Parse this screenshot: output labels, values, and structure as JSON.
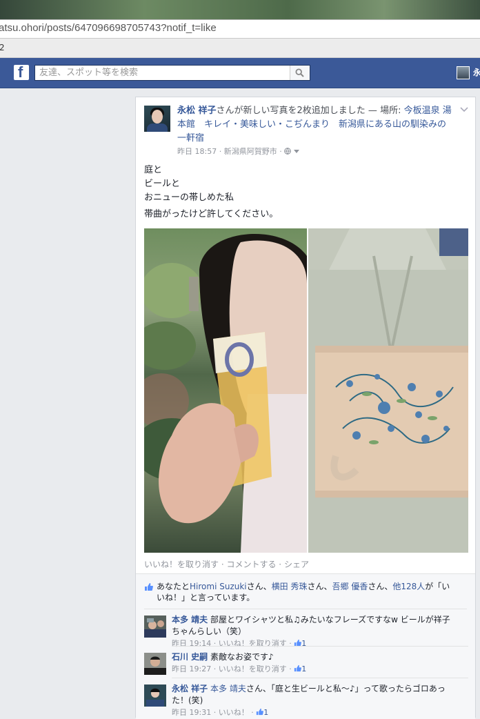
{
  "browser": {
    "url": "atsu.ohori/posts/647096698705743?notif_t=like",
    "tab_fragment": "2"
  },
  "fb_header": {
    "logo": "f",
    "search_placeholder": "友達、スポット等を検索",
    "user_name_fragment": "永"
  },
  "post": {
    "author": "永松 祥子",
    "action": "さんが新しい写真を2枚追加しました — 場所: ",
    "place": "今板温泉 湯本館　キレイ・美味しい・こぢんまり　新潟県にある山の馴染みの一軒宿",
    "time": "昨日 18:57",
    "location": "新潟県阿賀野市",
    "text_lines": [
      "庭と",
      "ビールと",
      "おニューの帯しめた私"
    ],
    "text_line_extra": "帯曲がったけど許してください。",
    "actions": {
      "unlike": "いいね！を取り消す",
      "comment": "コメントする",
      "share": "シェア"
    }
  },
  "likes": {
    "prefix": "あなたと",
    "names": [
      "Hiromi Suzuki",
      "横田 秀珠",
      "吾郷 優香"
    ],
    "san": "さん",
    "others": "他128人",
    "suffix": "が「いいね！」と言っています。"
  },
  "comments": [
    {
      "author": "本多 靖夫",
      "text": "部屋とワイシャツと私♫みたいなフレーズですなw ビールが祥子ちゃんらしい（笑）",
      "time": "昨日 19:14",
      "unlike": "いいね！を取り消す",
      "likes": "1"
    },
    {
      "author": "石川 史嗣",
      "text": "素敵なお姿です♪",
      "time": "昨日 19:27",
      "unlike": "いいね！を取り消す",
      "likes": "1"
    },
    {
      "author": "永松 祥子",
      "mention": "本多 靖夫",
      "text": "さん、「庭と生ビールと私〜♪」って歌ったらゴロあった！(笑)",
      "time": "昨日 19:31",
      "unlike": "いいね！",
      "likes": "1"
    }
  ],
  "colors": {
    "fb_blue": "#3b5998",
    "link": "#365899",
    "meta": "#90949c"
  },
  "icons": [
    "facebook-logo-icon",
    "search-icon",
    "globe-icon",
    "chevron-down-icon",
    "thumbs-up-icon"
  ]
}
